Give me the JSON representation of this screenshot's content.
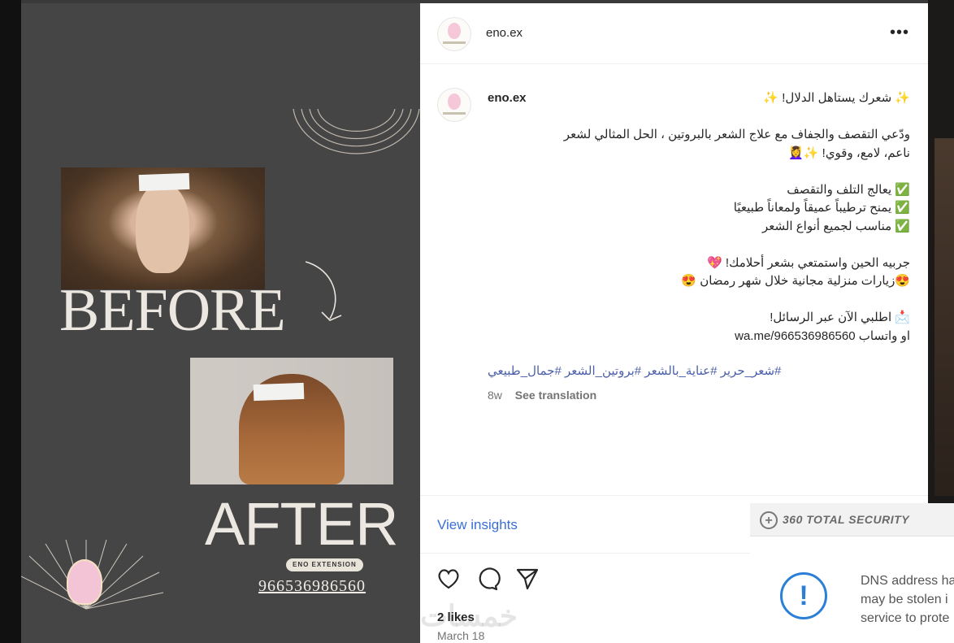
{
  "post": {
    "username": "eno.ex",
    "caption": {
      "title": "✨ شعرك يستاهل الدلال! ✨",
      "lines": [
        "ودّعي التقصف والجفاف مع علاج الشعر بالبروتين ، الحل المثالي لشعر",
        "ناعم، لامع، وقوي! ✨💆‍♀️",
        "",
        "✅ يعالج التلف والتقصف",
        "✅ يمنح ترطيباً عميقاً ولمعاناً طبيعيًا",
        "✅ مناسب لجميع أنواع الشعر",
        "",
        "جربيه الحين واستمتعي بشعر أحلامك! 💖",
        "😍زيارات منزلية مجانية خلال شهر رمضان 😍",
        "",
        "📩 اطلبي الآن عبر الرسائل!",
        "او واتساب wa.me/966536986560"
      ]
    },
    "hashtags": "#شعر_حرير #عناية_بالشعر #بروتين_الشعر #جمال_طبيعي",
    "time_ago": "8w",
    "see_translation": "See translation",
    "view_insights": "View insights",
    "likes": "2 likes",
    "date": "March 18",
    "watermark": "خمسات"
  },
  "image": {
    "before_label": "BEFORE",
    "after_label": "AFTER",
    "brand_badge": "ENO EXTENSION",
    "phone": "966536986560"
  },
  "icons": {
    "more": "more-options-icon",
    "like": "heart-icon",
    "comment": "comment-icon",
    "share": "share-icon"
  },
  "security_popup": {
    "title": "360 TOTAL SECURITY",
    "message_lines": [
      "DNS address ha",
      "may be stolen i",
      "service to prote"
    ]
  },
  "colors": {
    "link_blue": "#3a6fd8",
    "hashtag_blue": "#4a5fa8",
    "image_bg": "#454545",
    "alert_blue": "#2b7fd6"
  }
}
